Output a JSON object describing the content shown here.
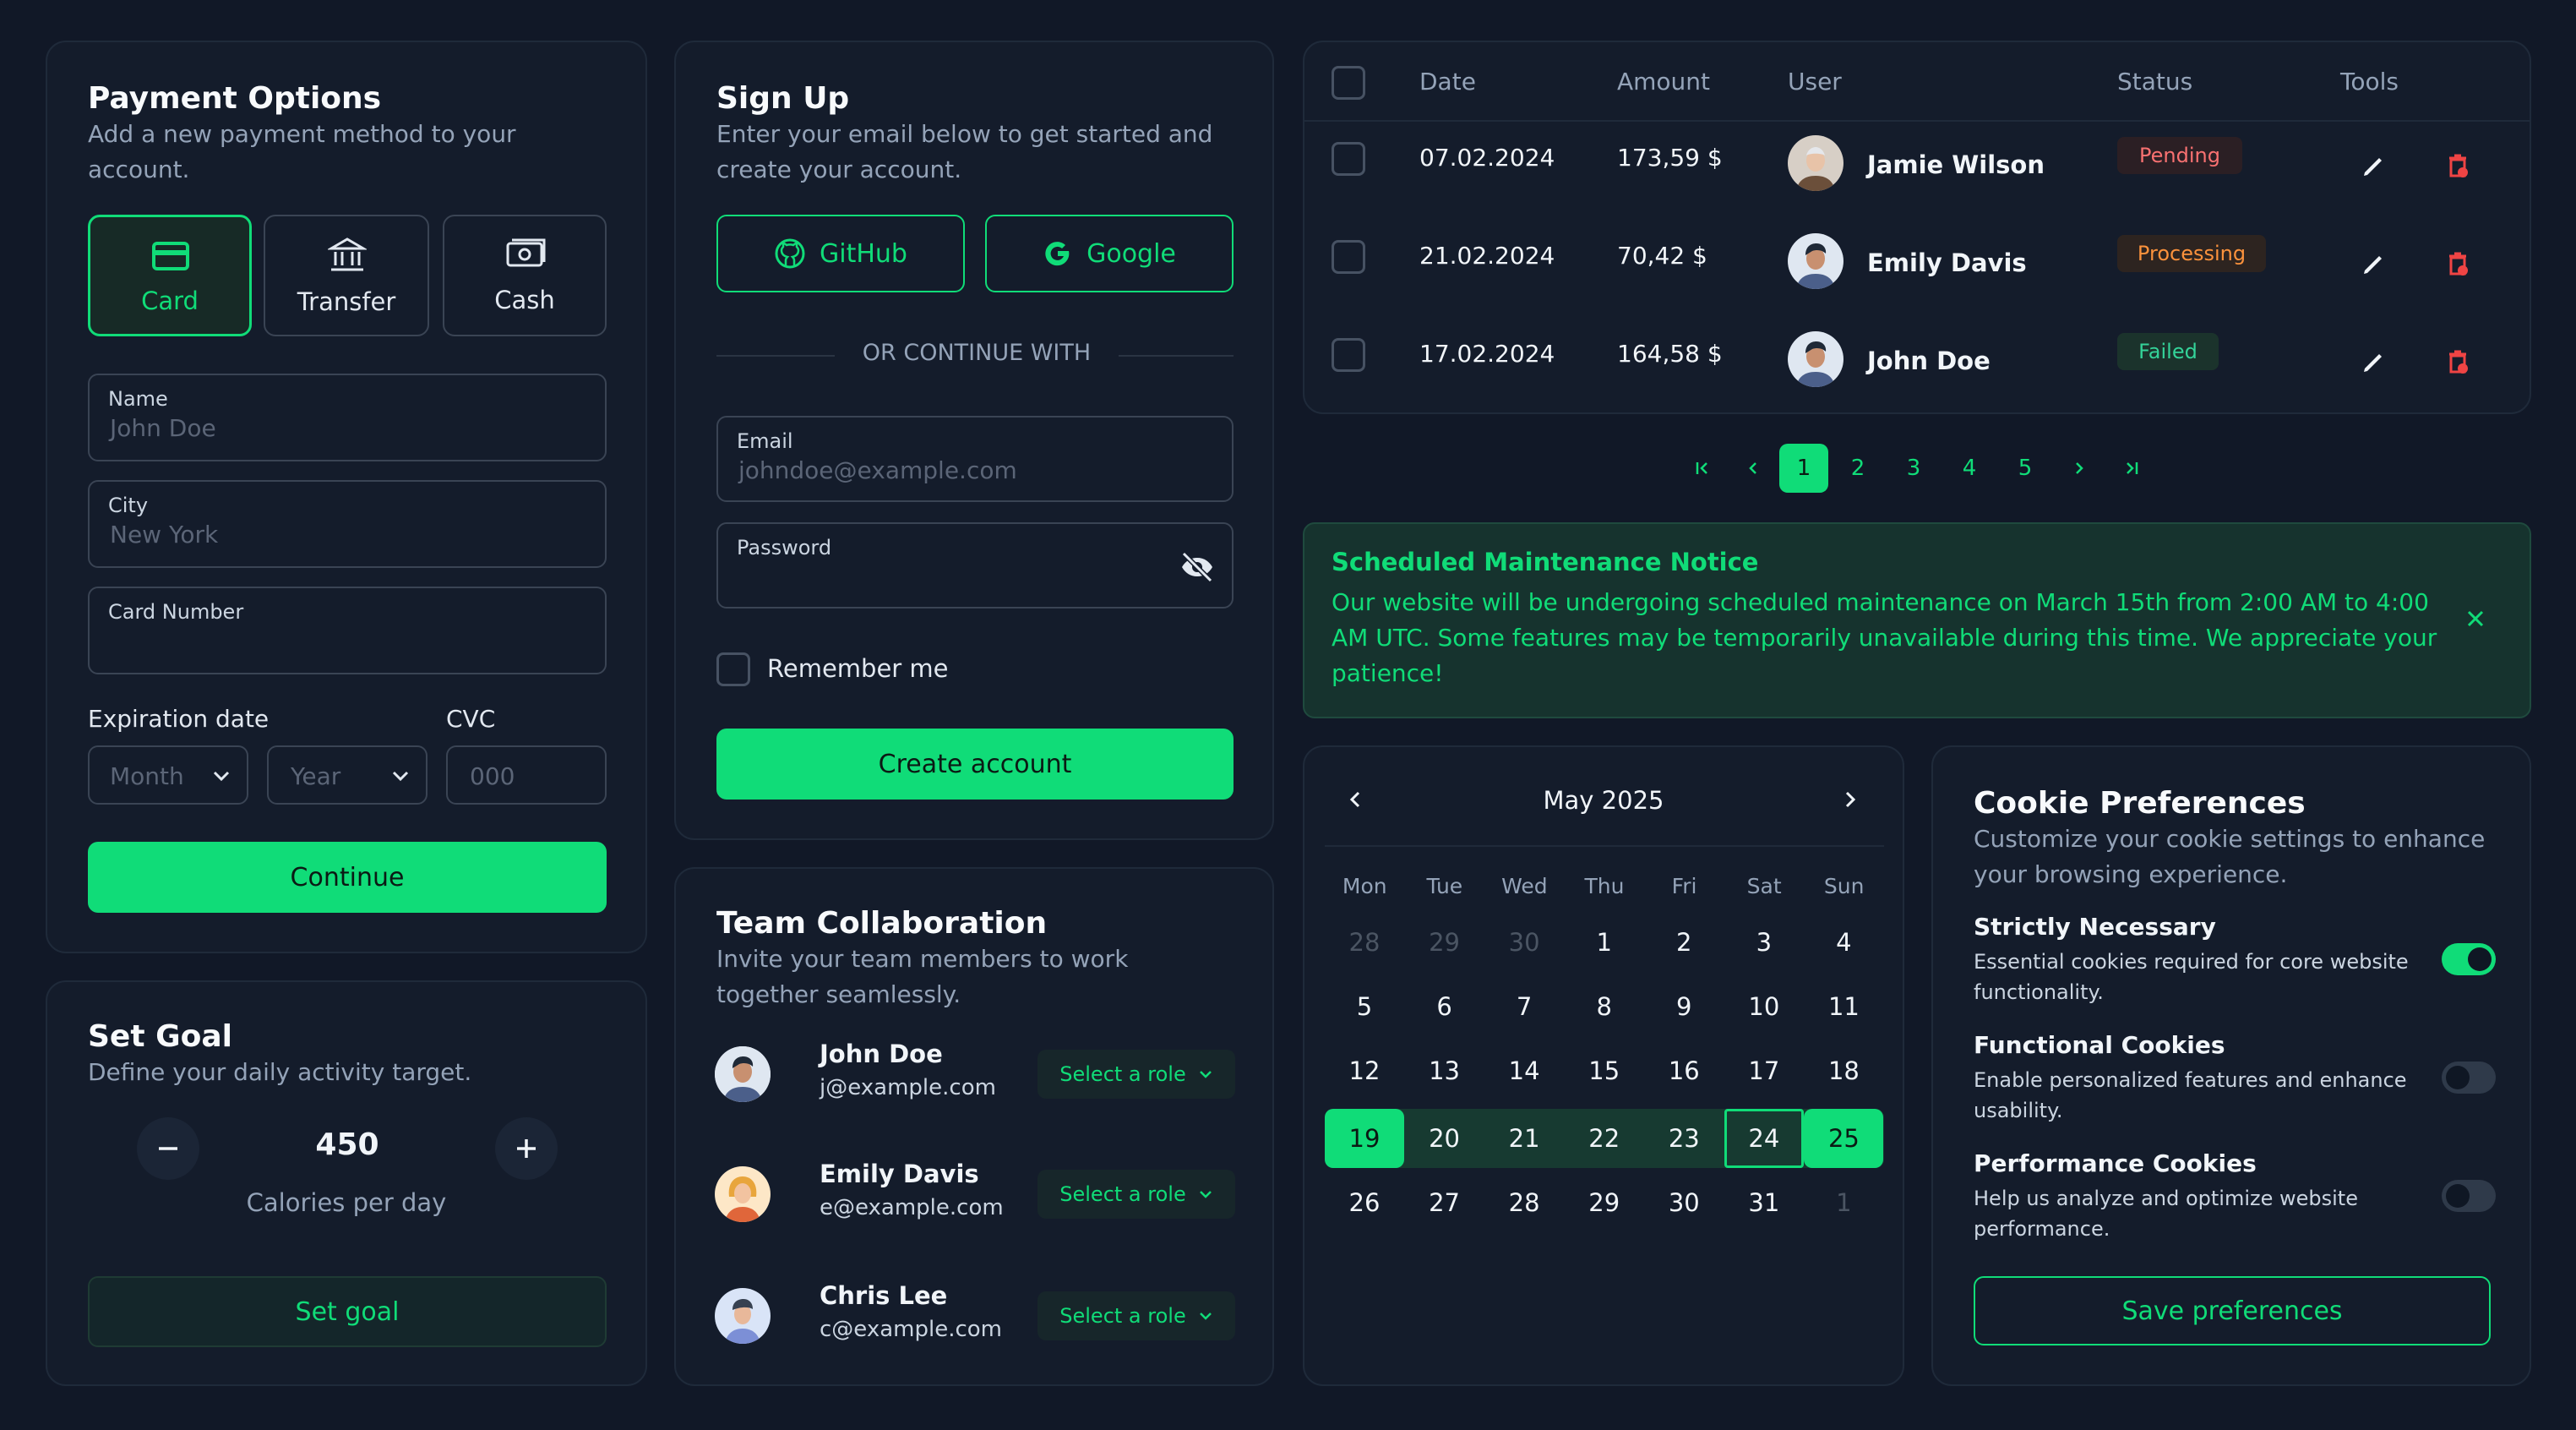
{
  "colors": {
    "accent": "#10dc78",
    "background": "#111827",
    "card": "#141c2b",
    "danger": "#ef4444",
    "pending": "#f87171",
    "processing": "#fb923c"
  },
  "payment": {
    "title": "Payment Options",
    "subtitle_line1": "Add a new payment method to your",
    "subtitle_line2": "account.",
    "methods": [
      {
        "label": "Card",
        "icon": "credit-card-icon",
        "selected": true
      },
      {
        "label": "Transfer",
        "icon": "bank-icon",
        "selected": false
      },
      {
        "label": "Cash",
        "icon": "cash-icon",
        "selected": false
      }
    ],
    "name_label": "Name",
    "name_placeholder": "John Doe",
    "city_label": "City",
    "city_placeholder": "New York",
    "card_label": "Card Number",
    "card_value": "",
    "exp_label": "Expiration date",
    "cvc_label": "CVC",
    "month_placeholder": "Month",
    "year_placeholder": "Year",
    "cvc_placeholder": "000",
    "continue": "Continue"
  },
  "goal": {
    "title": "Set Goal",
    "subtitle": "Define your daily activity target.",
    "value": "450",
    "unit": "Calories per day",
    "button": "Set goal"
  },
  "signup": {
    "title": "Sign Up",
    "subtitle_line1": "Enter your email below to get started and",
    "subtitle_line2": "create your account.",
    "github": "GitHub",
    "google": "Google",
    "divider": "OR CONTINUE WITH",
    "email_label": "Email",
    "email_placeholder": "johndoe@example.com",
    "password_label": "Password",
    "remember": "Remember me",
    "create": "Create account"
  },
  "team": {
    "title": "Team Collaboration",
    "subtitle_line1": "Invite your team members to work",
    "subtitle_line2": "together seamlessly.",
    "role_label": "Select a role",
    "members": [
      {
        "name": "John Doe",
        "email": "j@example.com"
      },
      {
        "name": "Emily Davis",
        "email": "e@example.com"
      },
      {
        "name": "Chris Lee",
        "email": "c@example.com"
      }
    ]
  },
  "table": {
    "headers": {
      "date": "Date",
      "amount": "Amount",
      "user": "User",
      "status": "Status",
      "tools": "Tools"
    },
    "rows": [
      {
        "date": "07.02.2024",
        "amount": "173,59 $",
        "user": "Jamie Wilson",
        "status": "Pending"
      },
      {
        "date": "21.02.2024",
        "amount": "70,42 $",
        "user": "Emily Davis",
        "status": "Processing"
      },
      {
        "date": "17.02.2024",
        "amount": "164,58 $",
        "user": "John Doe",
        "status": "Failed"
      }
    ]
  },
  "pagination": {
    "pages": [
      "1",
      "2",
      "3",
      "4",
      "5"
    ],
    "current": "1"
  },
  "notice": {
    "title": "Scheduled Maintenance Notice",
    "line1": "Our website will be undergoing scheduled maintenance on March 15th from 2:00 AM to 4:00",
    "line2": "AM UTC. Some features may be temporarily unavailable during this time. We appreciate your",
    "line3": "patience!"
  },
  "calendar": {
    "month": "May 2025",
    "weekdays": [
      "Mon",
      "Tue",
      "Wed",
      "Thu",
      "Fri",
      "Sat",
      "Sun"
    ],
    "weeks": [
      [
        "28",
        "29",
        "30",
        "1",
        "2",
        "3",
        "4"
      ],
      [
        "5",
        "6",
        "7",
        "8",
        "9",
        "10",
        "11"
      ],
      [
        "12",
        "13",
        "14",
        "15",
        "16",
        "17",
        "18"
      ],
      [
        "19",
        "20",
        "21",
        "22",
        "23",
        "24",
        "25"
      ],
      [
        "26",
        "27",
        "28",
        "29",
        "30",
        "31",
        "1"
      ]
    ],
    "range_start": "19",
    "range_end": "25",
    "today": "24"
  },
  "cookies": {
    "title": "Cookie Preferences",
    "subtitle_line1": "Customize your cookie settings to enhance",
    "subtitle_line2": "your browsing experience.",
    "items": [
      {
        "name": "Strictly Necessary",
        "desc1": "Essential cookies required for core website",
        "desc2": "functionality.",
        "enabled": true
      },
      {
        "name": "Functional Cookies",
        "desc1": "Enable personalized features and enhance",
        "desc2": "usability.",
        "enabled": false
      },
      {
        "name": "Performance Cookies",
        "desc1": "Help us analyze and optimize website",
        "desc2": "performance.",
        "enabled": false
      }
    ],
    "save": "Save preferences"
  }
}
